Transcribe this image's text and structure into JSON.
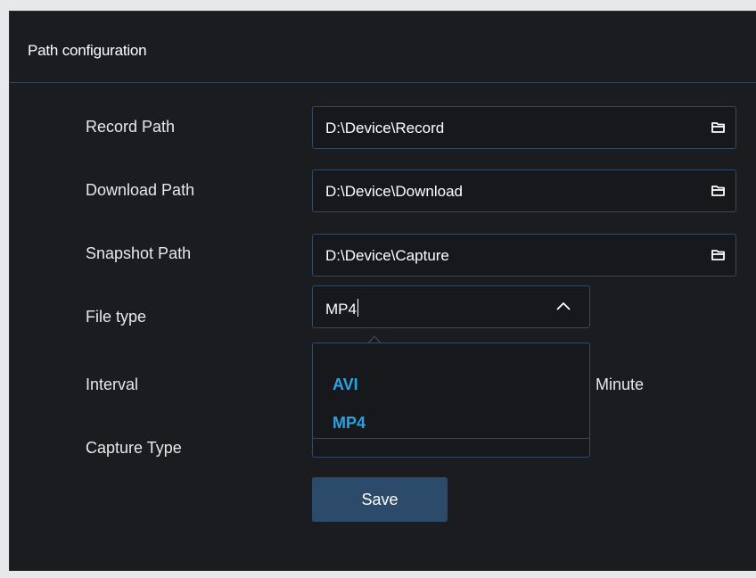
{
  "panel": {
    "title": "Path configuration"
  },
  "fields": {
    "record_path": {
      "label": "Record Path",
      "value": "D:\\Device\\Record",
      "icon": "folder-icon"
    },
    "download_path": {
      "label": "Download Path",
      "value": "D:\\Device\\Download",
      "icon": "folder-icon"
    },
    "snapshot_path": {
      "label": "Snapshot Path",
      "value": "D:\\Device\\Capture",
      "icon": "folder-icon"
    },
    "file_type": {
      "label": "File type",
      "value": "MP4",
      "icon": "chevron-up-icon",
      "options": [
        "AVI",
        "MP4"
      ]
    },
    "interval": {
      "label": "Interval",
      "unit": "Minute"
    },
    "capture_type": {
      "label": "Capture Type"
    }
  },
  "actions": {
    "save_label": "Save"
  },
  "colors": {
    "panel_bg": "#1b1c1f",
    "field_border": "#34495e",
    "option_text": "#29a3e6",
    "button_bg": "#2c4a69"
  }
}
